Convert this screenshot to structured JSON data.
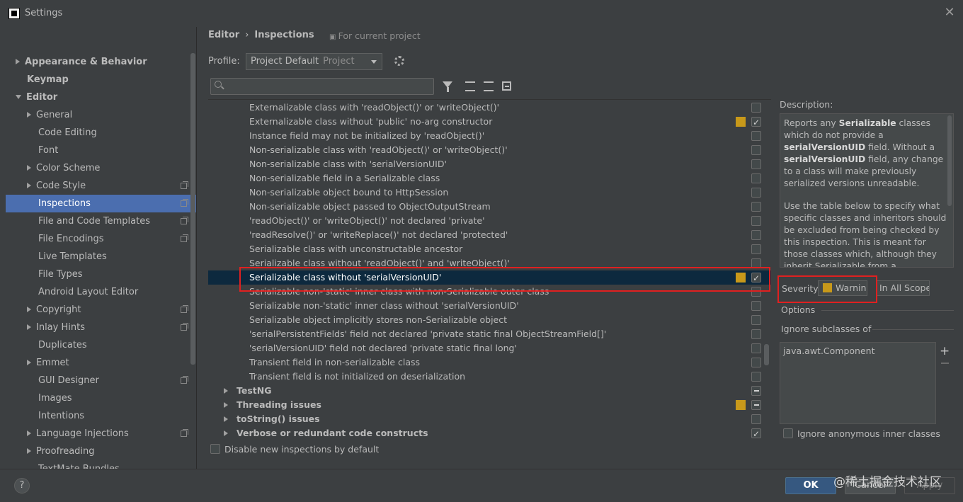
{
  "window": {
    "title": "Settings",
    "close_glyph": "✕"
  },
  "sidebar": {
    "items": [
      {
        "label": "Appearance & Behavior",
        "arrow": "right",
        "bold": true,
        "indent": 0
      },
      {
        "label": "Keymap",
        "arrow": "none",
        "bold": true,
        "indent": 0
      },
      {
        "label": "Editor",
        "arrow": "down",
        "bold": true,
        "indent": 0
      },
      {
        "label": "General",
        "arrow": "right",
        "indent": 1
      },
      {
        "label": "Code Editing",
        "arrow": "none",
        "indent": 1
      },
      {
        "label": "Font",
        "arrow": "none",
        "indent": 1
      },
      {
        "label": "Color Scheme",
        "arrow": "right",
        "indent": 1
      },
      {
        "label": "Code Style",
        "arrow": "right",
        "indent": 1,
        "copy": true
      },
      {
        "label": "Inspections",
        "arrow": "none",
        "indent": 1,
        "copy": true,
        "selected": true
      },
      {
        "label": "File and Code Templates",
        "arrow": "none",
        "indent": 1,
        "copy": true
      },
      {
        "label": "File Encodings",
        "arrow": "none",
        "indent": 1,
        "copy": true
      },
      {
        "label": "Live Templates",
        "arrow": "none",
        "indent": 1
      },
      {
        "label": "File Types",
        "arrow": "none",
        "indent": 1
      },
      {
        "label": "Android Layout Editor",
        "arrow": "none",
        "indent": 1
      },
      {
        "label": "Copyright",
        "arrow": "right",
        "indent": 1,
        "copy": true
      },
      {
        "label": "Inlay Hints",
        "arrow": "right",
        "indent": 1,
        "copy": true
      },
      {
        "label": "Duplicates",
        "arrow": "none",
        "indent": 1
      },
      {
        "label": "Emmet",
        "arrow": "right",
        "indent": 1
      },
      {
        "label": "GUI Designer",
        "arrow": "none",
        "indent": 1,
        "copy": true
      },
      {
        "label": "Images",
        "arrow": "none",
        "indent": 1
      },
      {
        "label": "Intentions",
        "arrow": "none",
        "indent": 1
      },
      {
        "label": "Language Injections",
        "arrow": "right",
        "indent": 1,
        "copy": true
      },
      {
        "label": "Proofreading",
        "arrow": "right",
        "indent": 1
      },
      {
        "label": "TextMate Bundles",
        "arrow": "none",
        "indent": 1
      }
    ]
  },
  "header": {
    "breadcrumb_editor": "Editor",
    "breadcrumb_sep": "›",
    "breadcrumb_inspections": "Inspections",
    "for_project": "For current project"
  },
  "profile": {
    "label": "Profile:",
    "value": "Project Default",
    "sub": "Project"
  },
  "inspections": {
    "rows": [
      {
        "label": "Externalizable class with 'readObject()' or 'writeObject()'",
        "check": "none"
      },
      {
        "label": "Externalizable class without 'public' no-arg constructor",
        "check": "checked",
        "swatch": true
      },
      {
        "label": "Instance field may not be initialized by 'readObject()'",
        "check": "none"
      },
      {
        "label": "Non-serializable class with 'readObject()' or 'writeObject()'",
        "check": "none"
      },
      {
        "label": "Non-serializable class with 'serialVersionUID'",
        "check": "none"
      },
      {
        "label": "Non-serializable field in a Serializable class",
        "check": "none"
      },
      {
        "label": "Non-serializable object bound to HttpSession",
        "check": "none"
      },
      {
        "label": "Non-serializable object passed to ObjectOutputStream",
        "check": "none"
      },
      {
        "label": "'readObject()' or 'writeObject()' not declared 'private'",
        "check": "none"
      },
      {
        "label": "'readResolve()' or 'writeReplace()' not declared 'protected'",
        "check": "none"
      },
      {
        "label": "Serializable class with unconstructable ancestor",
        "check": "none"
      },
      {
        "label": "Serializable class without 'readObject()' and 'writeObject()'",
        "check": "none"
      },
      {
        "label": "Serializable class without 'serialVersionUID'",
        "check": "checked",
        "swatch": true,
        "selected": true
      },
      {
        "label": "Serializable non-'static' inner class with non-Serializable outer class",
        "check": "none"
      },
      {
        "label": "Serializable non-'static' inner class without 'serialVersionUID'",
        "check": "none"
      },
      {
        "label": "Serializable object implicitly stores non-Serializable object",
        "check": "none"
      },
      {
        "label": "'serialPersistentFields' field not declared 'private static final ObjectStreamField[]'",
        "check": "none"
      },
      {
        "label": "'serialVersionUID' field not declared 'private static final long'",
        "check": "none"
      },
      {
        "label": "Transient field in non-serializable class",
        "check": "none"
      },
      {
        "label": "Transient field is not initialized on deserialization",
        "check": "none"
      },
      {
        "label": "TestNG",
        "check": "minus",
        "group": true
      },
      {
        "label": "Threading issues",
        "check": "minus",
        "group": true,
        "swatch": true
      },
      {
        "label": "toString() issues",
        "check": "none",
        "group": true
      },
      {
        "label": "Verbose or redundant code constructs",
        "check": "checked",
        "group": true
      }
    ],
    "disable_new": "Disable new inspections by default"
  },
  "description": {
    "label": "Description:",
    "p1": [
      "Reports any ",
      "Serializable",
      " classes which do not provide a ",
      "serialVersionUID",
      " field. Without a ",
      "serialVersionUID",
      " field, any change to a class will make previously serialized versions unreadable."
    ],
    "p2": "Use the table below to specify what specific classes and inheritors should be excluded from being checked by this inspection. This is meant for those classes which, although they inherit Serializable from a"
  },
  "severity": {
    "label": "Severity:",
    "value": "Warning",
    "scope": "In All Scopes"
  },
  "options": {
    "label": "Options",
    "ignore_subclasses_label": "Ignore subclasses of",
    "ignore_list": [
      "java.awt.Component"
    ],
    "add_glyph": "+",
    "anonymous_label": "Ignore anonymous inner classes"
  },
  "buttons": {
    "help": "?",
    "ok": "OK",
    "cancel": "Cancel",
    "apply": "Apply"
  },
  "watermark": "@稀土掘金技术社区",
  "colors": {
    "accent": "#4b6eaf",
    "selected_row": "#0d293e",
    "warning": "#c8991a",
    "highlight": "#e02020"
  }
}
